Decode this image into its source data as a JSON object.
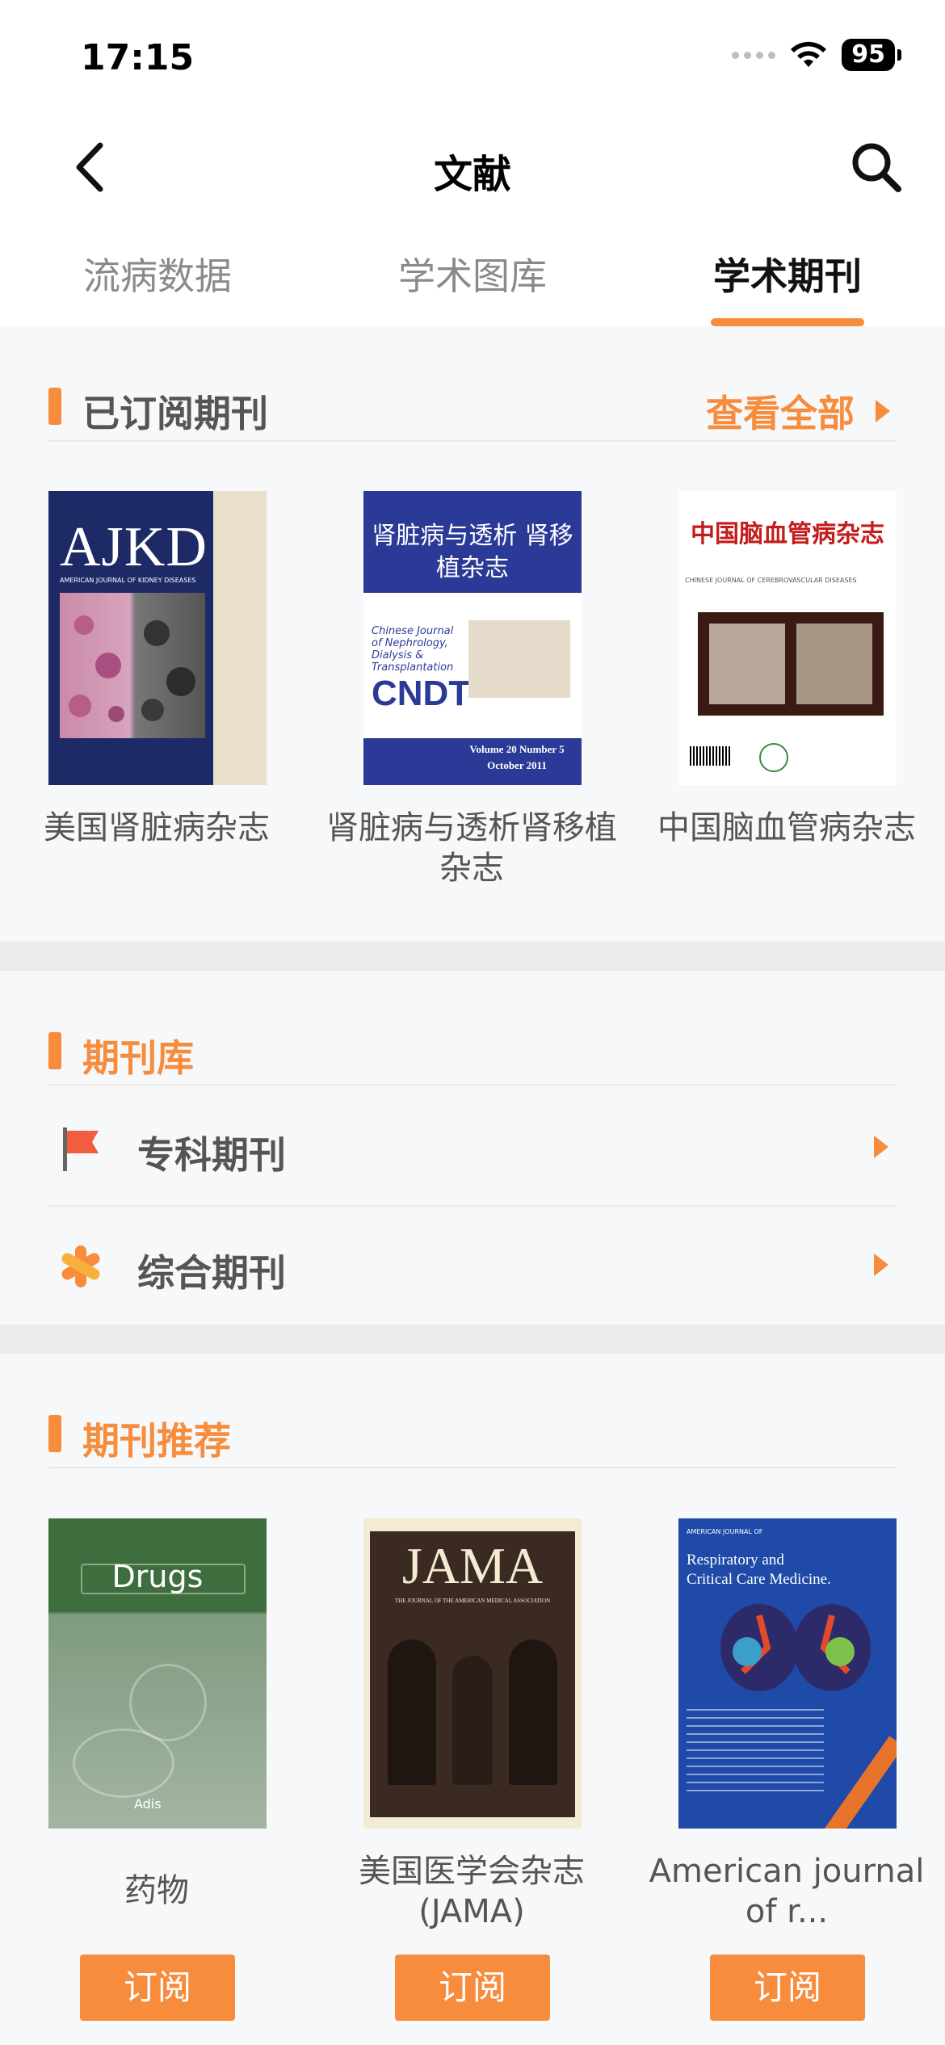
{
  "status": {
    "time": "17:15",
    "battery": "95"
  },
  "nav": {
    "title": "文献"
  },
  "tabs": [
    {
      "label": "流病数据"
    },
    {
      "label": "学术图库"
    },
    {
      "label": "学术期刊"
    }
  ],
  "subscribed": {
    "title": "已订阅期刊",
    "see_all": "查看全部",
    "items": [
      {
        "title": "美国肾脏病杂志",
        "cover": {
          "logo": "AJKD",
          "sub": "AMERICAN JOURNAL OF KIDNEY DISEASES"
        }
      },
      {
        "title": "肾脏病与透析肾移植杂志",
        "cover": {
          "cn_title": "肾脏病与透析 肾移植杂志",
          "en_title": "Chinese Journal of Nephrology, Dialysis & Transplantation",
          "abbr": "CNDT",
          "issue": "Volume 20 Number 5",
          "date": "October 2011"
        }
      },
      {
        "title": "中国脑血管病杂志",
        "cover": {
          "cn_title": "中国脑血管病杂志",
          "en_title": "CHINESE JOURNAL OF CEREBROVASCULAR DISEASES"
        }
      }
    ]
  },
  "library": {
    "title": "期刊库",
    "items": [
      {
        "label": "专科期刊"
      },
      {
        "label": "综合期刊"
      }
    ]
  },
  "recommended": {
    "title": "期刊推荐",
    "subscribe_label": "订阅",
    "items": [
      {
        "title": "药物",
        "cover": {
          "name": "Drugs",
          "publisher": "Adis"
        }
      },
      {
        "title": "美国医学会杂志 (JAMA)",
        "cover": {
          "name": "JAMA",
          "sub": "THE JOURNAL OF THE AMERICAN MEDICAL ASSOCIATION"
        }
      },
      {
        "title": "American journal of r...",
        "cover": {
          "top": "AMERICAN JOURNAL OF",
          "name": "Respiratory and Critical Care Medicine."
        }
      }
    ]
  },
  "colors": {
    "accent": "#f78c3c",
    "background": "#f7f8fa",
    "band": "#ebebeb"
  }
}
